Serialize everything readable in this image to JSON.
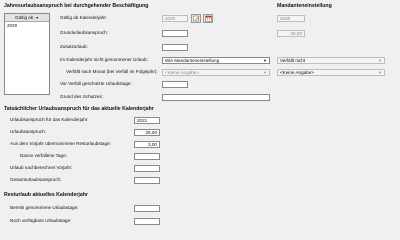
{
  "sections": {
    "durchgehend": "Jahresurlaubsanspruch bei durchgehender Beschäftigung",
    "mandant": "Mandanteneinstellung",
    "tatsaechlich": "Tatsächlicher Urlaubsanspruch für das aktuelle Kalenderjahr",
    "resturlaub": "Resturlaub aktuelles Kalenderjahr"
  },
  "valid_list": {
    "header": "Gültig ab",
    "items": [
      "2020"
    ]
  },
  "form": {
    "gueltig_label": "Gültig ab Kalenderjahr:",
    "gueltig_value": "2020",
    "mandant_gueltig_value": "2020",
    "grund_label": "Grundurlaubsanspruch:",
    "grund_value": "",
    "mandant_grund_value": "28,00",
    "zusatz_label": "Zusatzurlaub:",
    "zusatz_value": "",
    "nicht_genommen_label": "Im Kalenderjahr nicht genommener Urlaub:",
    "nicht_genommen_value": "Wie Mandanteneinstellung",
    "mandant_nicht_genommen_value": "Verfällt nicht",
    "verfaellt_monat_label": "Verfällt nach Monat (bei Verfall im Folgejahr):",
    "verfaellt_monat_value": "<Keine Angabe>",
    "mandant_verfaellt_monat_value": "<Keine Angabe>",
    "vor_verfall_label": "Vor Verfall geschützte Urlaubstage:",
    "vor_verfall_value": "",
    "grund_schutz_label": "Grund des Schutzes:",
    "grund_schutz_value": ""
  },
  "actual": {
    "kalenderjahr_label": "Urlaubsanspruch für das Kalenderjahr:",
    "kalenderjahr_value": "2021",
    "anspruch_label": "Urlaubsanspruch:",
    "anspruch_value": "28,00",
    "vorjahr_label": "Aus dem Vorjahr übernommene Resturlaubstage:",
    "vorjahr_value": "3,00",
    "verfallen_label": "Davon verfallene Tage:",
    "verfallen_value": "",
    "nachberechnet_label": "Urlaub nachberechnet Vorjahr:",
    "nachberechnet_value": "",
    "gesamt_label": "Gesamturlaubsanspruch:",
    "gesamt_value": ""
  },
  "rest": {
    "genommen_label": "Bereits genommene Urlaubstage:",
    "genommen_value": "",
    "verfuegbar_label": "Noch verfügbare Urlaubstage:",
    "verfuegbar_value": ""
  },
  "icons": {
    "edit": "edit-icon",
    "calendar": "calendar-icon",
    "dropdown": "chevron-down-icon"
  },
  "colors": {
    "background": "#f0f0f0",
    "field": "#ffffff",
    "field_border": "#8a8a8a",
    "disabled_text": "#8a8a8a"
  }
}
